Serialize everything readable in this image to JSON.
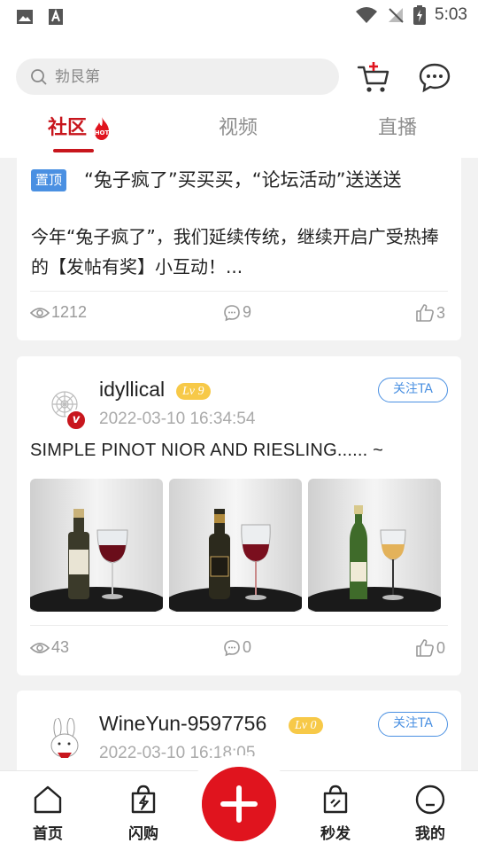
{
  "status_bar": {
    "time": "5:03"
  },
  "search": {
    "placeholder": "勃艮第"
  },
  "tabs": [
    {
      "label": "社区",
      "badge": "HOT",
      "active": true
    },
    {
      "label": "视频",
      "active": false
    },
    {
      "label": "直播",
      "active": false
    }
  ],
  "posts": [
    {
      "pinned_label": "置顶",
      "title": "“兔子疯了”买买买，“论坛活动”送送送",
      "body": "今年“兔子疯了”，我们延续传统，继续开启广受热捧的【发帖有奖】小互动！...",
      "views": "1212",
      "comments": "9",
      "likes": "3"
    },
    {
      "username": "idyllical",
      "level": "Lv 9",
      "verified_badge": "v",
      "time": "2022-03-10 16:34:54",
      "follow_label": "关注TA",
      "title": "SIMPLE PINOT NIOR AND RIESLING...... ~",
      "views": "43",
      "comments": "0",
      "likes": "0"
    },
    {
      "username": "WineYun-9597756",
      "level": "Lv 0",
      "time": "2022-03-10 16:18:05",
      "follow_label": "关注TA"
    }
  ],
  "bottom_nav": [
    {
      "label": "首页"
    },
    {
      "label": "闪购"
    },
    {
      "label": "秒发"
    },
    {
      "label": "我的"
    }
  ],
  "colors": {
    "brand_red": "#c8161d",
    "accent_blue": "#4a90e2",
    "level_gold": "#f7c948"
  }
}
